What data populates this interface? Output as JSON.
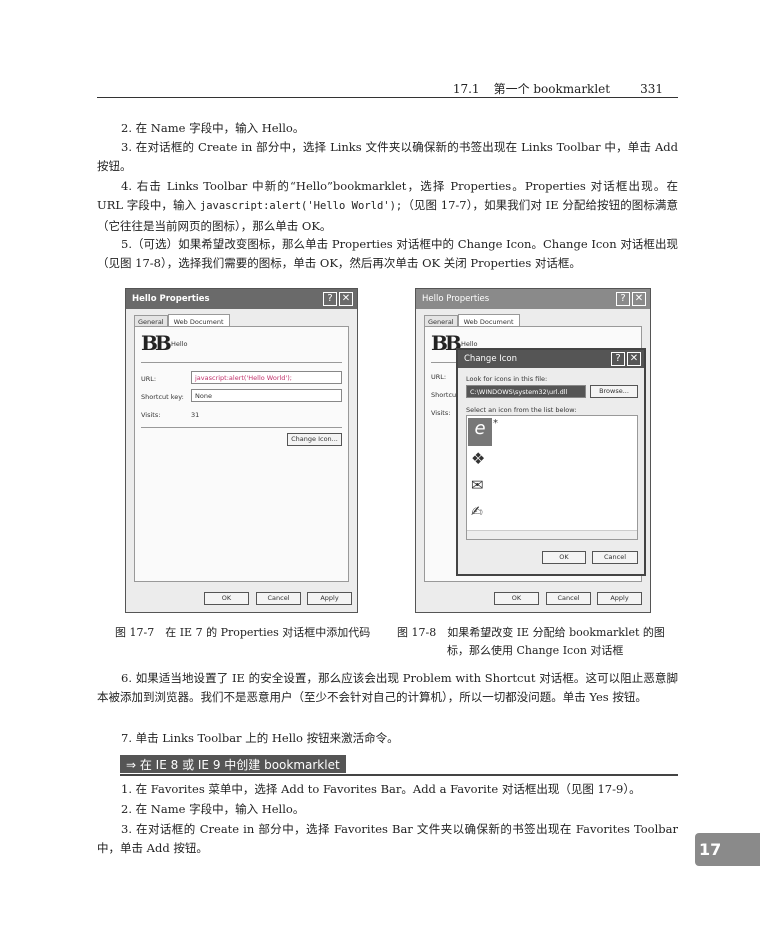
{
  "header": {
    "section": "17.1",
    "title": "第一个 bookmarklet",
    "page": "331"
  },
  "paragraphs_top": [
    "2. 在 Name 字段中，输入 Hello。",
    "3. 在对话框的 Create in 部分中，选择 Links 文件夹以确保新的书签出现在 Links Toolbar 中，单击 Add 按钮。",
    {
      "before": "4. 右击 Links Toolbar 中新的“Hello”bookmarklet，选择 Properties。Properties 对话框出现。在 URL 字段中，输入 ",
      "code": "javascript:alert('Hello World');",
      "after": "（见图 17-7），如果我们对 IE 分配给按钮的图标满意（它往往是当前网页的图标），那么单击 OK。"
    },
    "5.（可选）如果希望改变图标，那么单击 Properties 对话框中的 Change Icon。Change Icon 对话框出现（见图 17-8），选择我们需要的图标，单击 OK，然后再次单击 OK 关闭 Properties 对话框。"
  ],
  "fig1": {
    "title": "Hello Properties",
    "tabs": [
      "General",
      "Web Document"
    ],
    "name": "Hello",
    "url_label": "URL:",
    "url_value": "javascript:alert('Hello World');",
    "shortcut_label": "Shortcut key:",
    "shortcut_value": "None",
    "visits_label": "Visits:",
    "visits_value": "31",
    "change_icon": "Change Icon...",
    "ok": "OK",
    "cancel": "Cancel",
    "apply": "Apply"
  },
  "fig2": {
    "title": "Hello Properties",
    "tabs": [
      "General",
      "Web Document"
    ],
    "name": "Hello",
    "url_label": "URL:",
    "shortcut_label": "Shortcut",
    "visits_label": "Visits:",
    "ok": "OK",
    "cancel": "Cancel",
    "apply": "Apply",
    "change_icon": {
      "title": "Change Icon",
      "look_label": "Look for icons in this file:",
      "file": "C:\\WINDOWS\\system32\\url.dll",
      "browse": "Browse...",
      "select_label": "Select an icon from the list below:",
      "ok": "OK",
      "cancel": "Cancel"
    }
  },
  "captions": {
    "fig1": "图 17-7　在 IE 7 的 Properties 对话框中添加代码",
    "fig2": "图 17-8　如果希望改变 IE 分配给 bookmarklet 的图标，那么使用 Change Icon 对话框"
  },
  "paragraphs_mid": [
    "6. 如果适当地设置了 IE 的安全设置，那么应该会出现 Problem with Shortcut 对话框。这可以阻止恶意脚本被添加到浏览器。我们不是恶意用户（至少不会针对自己的计算机），所以一切都没问题。单击 Yes 按钮。",
    "7. 单击 Links Toolbar 上的 Hello 按钮来激活命令。"
  ],
  "section_heading": "⇒ 在 IE 8 或 IE 9 中创建 bookmarklet",
  "paragraphs_bottom": [
    "1. 在 Favorites 菜单中，选择 Add to Favorites Bar。Add a Favorite 对话框出现（见图 17-9）。",
    "2. 在 Name 字段中，输入 Hello。",
    "3. 在对话框的 Create in 部分中，选择 Favorites Bar 文件夹以确保新的书签出现在 Favorites Toolbar 中，单击 Add 按钮。"
  ],
  "chapter_tab": "17"
}
